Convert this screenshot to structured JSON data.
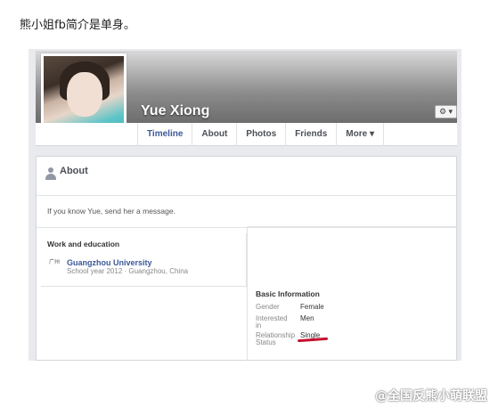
{
  "caption": "熊小姐fb简介是单身。",
  "profile": {
    "name": "Yue Xiong",
    "settings_icon": "gear-icon",
    "settings_label": "⚙ ▾"
  },
  "tabs": [
    "Timeline",
    "About",
    "Photos",
    "Friends",
    "More ▾"
  ],
  "about": {
    "title": "About",
    "icon": "person-icon",
    "message": "If you know Yue, send her a message."
  },
  "work": {
    "title": "Work and education",
    "logo_text": "广州",
    "school": "Guangzhou University",
    "detail": "School year 2012 · Guangzhou, China"
  },
  "basic": {
    "title": "Basic Information",
    "rows": [
      {
        "key": "Gender",
        "value": "Female"
      },
      {
        "key": "Interested in",
        "value": "Men"
      },
      {
        "key": "Relationship Status",
        "value": "Single"
      }
    ]
  },
  "watermark": "@全国反熊小萌联盟",
  "colors": {
    "link": "#3b5998",
    "underline": "#c8102e"
  }
}
